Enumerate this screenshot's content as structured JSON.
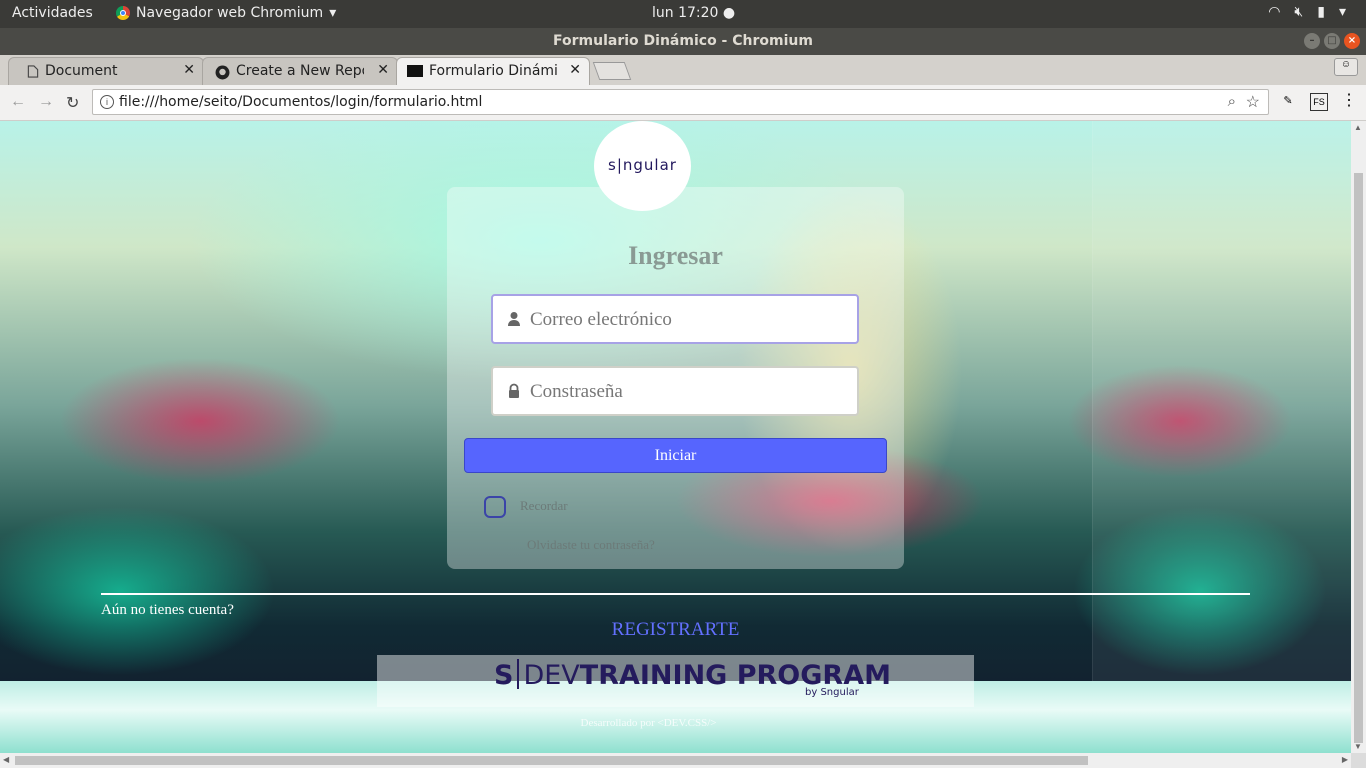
{
  "topbar": {
    "activities": "Actividades",
    "app_name": "Navegador web Chromium",
    "app_menu_icon": "chevron-down-icon",
    "clock": "lun 17:20",
    "tray_icons": [
      "wifi-icon",
      "volume-muted-icon",
      "battery-icon",
      "chevron-down-icon"
    ]
  },
  "window": {
    "title": "Formulario Dinámico - Chromium"
  },
  "tabs": [
    {
      "label": "Document",
      "icon": "document-icon",
      "active": false
    },
    {
      "label": "Create a New Repos",
      "icon": "github-icon",
      "active": false
    },
    {
      "label": "Formulario Dinámic",
      "icon": "singular-favicon",
      "active": true
    }
  ],
  "toolbar": {
    "url": "file:///home/seito/Documentos/login/formulario.html"
  },
  "page": {
    "logo_text": "s|ngular",
    "heading": "Ingresar",
    "email_placeholder": "Correo electrónico",
    "password_placeholder": "Constraseña",
    "submit_label": "Iniciar",
    "remember_label": "Recordar",
    "forgot_label": "Olvidaste tu contraseña?",
    "no_account": "Aún no tienes cuenta?",
    "register_label": "REGISTRARTE",
    "banner": {
      "s": "S",
      "dev": "DEV",
      "training": "TRAINING PROGRAM",
      "by": "by Sngular"
    },
    "credit": "Desarrollado por <DEV.CSS/>"
  },
  "colors": {
    "accent": "#5665fe",
    "register": "#6370ff",
    "brand": "#241b5d"
  }
}
